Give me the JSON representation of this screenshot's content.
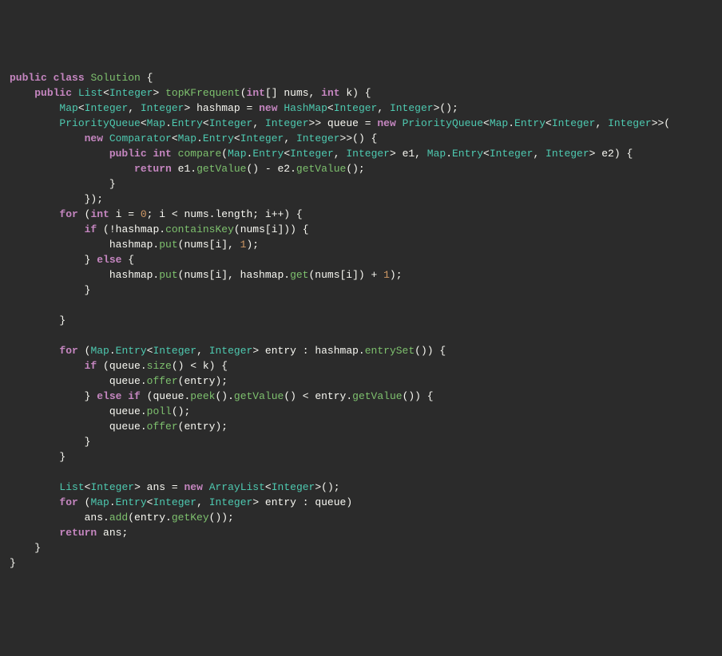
{
  "code_tokens": [
    [
      {
        "t": "public",
        "c": "kw"
      },
      {
        "t": " ",
        "c": "op"
      },
      {
        "t": "class",
        "c": "kw"
      },
      {
        "t": " ",
        "c": "op"
      },
      {
        "t": "Solution",
        "c": "cls"
      },
      {
        "t": " {",
        "c": "punc"
      }
    ],
    [
      {
        "t": "    ",
        "c": "op"
      },
      {
        "t": "public",
        "c": "kw"
      },
      {
        "t": " ",
        "c": "op"
      },
      {
        "t": "List",
        "c": "type"
      },
      {
        "t": "<",
        "c": "punc"
      },
      {
        "t": "Integer",
        "c": "type"
      },
      {
        "t": "> ",
        "c": "punc"
      },
      {
        "t": "topKFrequent",
        "c": "method"
      },
      {
        "t": "(",
        "c": "punc"
      },
      {
        "t": "int",
        "c": "kw"
      },
      {
        "t": "[] nums, ",
        "c": "punc"
      },
      {
        "t": "int",
        "c": "kw"
      },
      {
        "t": " k) {",
        "c": "punc"
      }
    ],
    [
      {
        "t": "        ",
        "c": "op"
      },
      {
        "t": "Map",
        "c": "type"
      },
      {
        "t": "<",
        "c": "punc"
      },
      {
        "t": "Integer",
        "c": "type"
      },
      {
        "t": ", ",
        "c": "punc"
      },
      {
        "t": "Integer",
        "c": "type"
      },
      {
        "t": "> hashmap = ",
        "c": "punc"
      },
      {
        "t": "new",
        "c": "new"
      },
      {
        "t": " ",
        "c": "op"
      },
      {
        "t": "HashMap",
        "c": "type"
      },
      {
        "t": "<",
        "c": "punc"
      },
      {
        "t": "Integer",
        "c": "type"
      },
      {
        "t": ", ",
        "c": "punc"
      },
      {
        "t": "Integer",
        "c": "type"
      },
      {
        "t": ">();",
        "c": "punc"
      }
    ],
    [
      {
        "t": "        ",
        "c": "op"
      },
      {
        "t": "PriorityQueue",
        "c": "type"
      },
      {
        "t": "<",
        "c": "punc"
      },
      {
        "t": "Map",
        "c": "type"
      },
      {
        "t": ".",
        "c": "punc"
      },
      {
        "t": "Entry",
        "c": "type"
      },
      {
        "t": "<",
        "c": "punc"
      },
      {
        "t": "Integer",
        "c": "type"
      },
      {
        "t": ", ",
        "c": "punc"
      },
      {
        "t": "Integer",
        "c": "type"
      },
      {
        "t": ">> queue = ",
        "c": "punc"
      },
      {
        "t": "new",
        "c": "new"
      },
      {
        "t": " ",
        "c": "op"
      },
      {
        "t": "PriorityQueue",
        "c": "type"
      },
      {
        "t": "<",
        "c": "punc"
      },
      {
        "t": "Map",
        "c": "type"
      },
      {
        "t": ".",
        "c": "punc"
      },
      {
        "t": "Entry",
        "c": "type"
      },
      {
        "t": "<",
        "c": "punc"
      },
      {
        "t": "Integer",
        "c": "type"
      },
      {
        "t": ", ",
        "c": "punc"
      },
      {
        "t": "Integer",
        "c": "type"
      },
      {
        "t": ">>(",
        "c": "punc"
      }
    ],
    [
      {
        "t": "            ",
        "c": "op"
      },
      {
        "t": "new",
        "c": "new"
      },
      {
        "t": " ",
        "c": "op"
      },
      {
        "t": "Comparator",
        "c": "type"
      },
      {
        "t": "<",
        "c": "punc"
      },
      {
        "t": "Map",
        "c": "type"
      },
      {
        "t": ".",
        "c": "punc"
      },
      {
        "t": "Entry",
        "c": "type"
      },
      {
        "t": "<",
        "c": "punc"
      },
      {
        "t": "Integer",
        "c": "type"
      },
      {
        "t": ", ",
        "c": "punc"
      },
      {
        "t": "Integer",
        "c": "type"
      },
      {
        "t": ">>() {",
        "c": "punc"
      }
    ],
    [
      {
        "t": "                ",
        "c": "op"
      },
      {
        "t": "public",
        "c": "kw"
      },
      {
        "t": " ",
        "c": "op"
      },
      {
        "t": "int",
        "c": "kw"
      },
      {
        "t": " ",
        "c": "op"
      },
      {
        "t": "compare",
        "c": "method"
      },
      {
        "t": "(",
        "c": "punc"
      },
      {
        "t": "Map",
        "c": "type"
      },
      {
        "t": ".",
        "c": "punc"
      },
      {
        "t": "Entry",
        "c": "type"
      },
      {
        "t": "<",
        "c": "punc"
      },
      {
        "t": "Integer",
        "c": "type"
      },
      {
        "t": ", ",
        "c": "punc"
      },
      {
        "t": "Integer",
        "c": "type"
      },
      {
        "t": "> e1, ",
        "c": "punc"
      },
      {
        "t": "Map",
        "c": "type"
      },
      {
        "t": ".",
        "c": "punc"
      },
      {
        "t": "Entry",
        "c": "type"
      },
      {
        "t": "<",
        "c": "punc"
      },
      {
        "t": "Integer",
        "c": "type"
      },
      {
        "t": ", ",
        "c": "punc"
      },
      {
        "t": "Integer",
        "c": "type"
      },
      {
        "t": "> e2) {",
        "c": "punc"
      }
    ],
    [
      {
        "t": "                    ",
        "c": "op"
      },
      {
        "t": "return",
        "c": "ret"
      },
      {
        "t": " e1.",
        "c": "punc"
      },
      {
        "t": "getValue",
        "c": "method"
      },
      {
        "t": "() - e2.",
        "c": "punc"
      },
      {
        "t": "getValue",
        "c": "method"
      },
      {
        "t": "();",
        "c": "punc"
      }
    ],
    [
      {
        "t": "                }",
        "c": "punc"
      }
    ],
    [
      {
        "t": "            });",
        "c": "punc"
      }
    ],
    [
      {
        "t": "        ",
        "c": "op"
      },
      {
        "t": "for",
        "c": "kw"
      },
      {
        "t": " (",
        "c": "punc"
      },
      {
        "t": "int",
        "c": "kw"
      },
      {
        "t": " i = ",
        "c": "punc"
      },
      {
        "t": "0",
        "c": "num"
      },
      {
        "t": "; i < nums.length; i++) {",
        "c": "punc"
      }
    ],
    [
      {
        "t": "            ",
        "c": "op"
      },
      {
        "t": "if",
        "c": "kw"
      },
      {
        "t": " (!hashmap.",
        "c": "punc"
      },
      {
        "t": "containsKey",
        "c": "method"
      },
      {
        "t": "(nums[i])) {",
        "c": "punc"
      }
    ],
    [
      {
        "t": "                hashmap.",
        "c": "punc"
      },
      {
        "t": "put",
        "c": "method"
      },
      {
        "t": "(nums[i], ",
        "c": "punc"
      },
      {
        "t": "1",
        "c": "num"
      },
      {
        "t": ");",
        "c": "punc"
      }
    ],
    [
      {
        "t": "            } ",
        "c": "punc"
      },
      {
        "t": "else",
        "c": "kw"
      },
      {
        "t": " {",
        "c": "punc"
      }
    ],
    [
      {
        "t": "                hashmap.",
        "c": "punc"
      },
      {
        "t": "put",
        "c": "method"
      },
      {
        "t": "(nums[i], hashmap.",
        "c": "punc"
      },
      {
        "t": "get",
        "c": "method"
      },
      {
        "t": "(nums[i]) + ",
        "c": "punc"
      },
      {
        "t": "1",
        "c": "num"
      },
      {
        "t": ");",
        "c": "punc"
      }
    ],
    [
      {
        "t": "            }",
        "c": "punc"
      }
    ],
    [
      {
        "t": "",
        "c": "punc"
      }
    ],
    [
      {
        "t": "        }",
        "c": "punc"
      }
    ],
    [
      {
        "t": "",
        "c": "punc"
      }
    ],
    [
      {
        "t": "        ",
        "c": "op"
      },
      {
        "t": "for",
        "c": "kw"
      },
      {
        "t": " (",
        "c": "punc"
      },
      {
        "t": "Map",
        "c": "type"
      },
      {
        "t": ".",
        "c": "punc"
      },
      {
        "t": "Entry",
        "c": "type"
      },
      {
        "t": "<",
        "c": "punc"
      },
      {
        "t": "Integer",
        "c": "type"
      },
      {
        "t": ", ",
        "c": "punc"
      },
      {
        "t": "Integer",
        "c": "type"
      },
      {
        "t": "> entry : hashmap.",
        "c": "punc"
      },
      {
        "t": "entrySet",
        "c": "method"
      },
      {
        "t": "()) {",
        "c": "punc"
      }
    ],
    [
      {
        "t": "            ",
        "c": "op"
      },
      {
        "t": "if",
        "c": "kw"
      },
      {
        "t": " (queue.",
        "c": "punc"
      },
      {
        "t": "size",
        "c": "method"
      },
      {
        "t": "() < k) {",
        "c": "punc"
      }
    ],
    [
      {
        "t": "                queue.",
        "c": "punc"
      },
      {
        "t": "offer",
        "c": "method"
      },
      {
        "t": "(entry);",
        "c": "punc"
      }
    ],
    [
      {
        "t": "            } ",
        "c": "punc"
      },
      {
        "t": "else",
        "c": "kw"
      },
      {
        "t": " ",
        "c": "op"
      },
      {
        "t": "if",
        "c": "kw"
      },
      {
        "t": " (queue.",
        "c": "punc"
      },
      {
        "t": "peek",
        "c": "method"
      },
      {
        "t": "().",
        "c": "punc"
      },
      {
        "t": "getValue",
        "c": "method"
      },
      {
        "t": "() < entry.",
        "c": "punc"
      },
      {
        "t": "getValue",
        "c": "method"
      },
      {
        "t": "()) {",
        "c": "punc"
      }
    ],
    [
      {
        "t": "                queue.",
        "c": "punc"
      },
      {
        "t": "poll",
        "c": "method"
      },
      {
        "t": "();",
        "c": "punc"
      }
    ],
    [
      {
        "t": "                queue.",
        "c": "punc"
      },
      {
        "t": "offer",
        "c": "method"
      },
      {
        "t": "(entry);",
        "c": "punc"
      }
    ],
    [
      {
        "t": "            }",
        "c": "punc"
      }
    ],
    [
      {
        "t": "        }",
        "c": "punc"
      }
    ],
    [
      {
        "t": "",
        "c": "punc"
      }
    ],
    [
      {
        "t": "        ",
        "c": "op"
      },
      {
        "t": "List",
        "c": "type"
      },
      {
        "t": "<",
        "c": "punc"
      },
      {
        "t": "Integer",
        "c": "type"
      },
      {
        "t": "> ans = ",
        "c": "punc"
      },
      {
        "t": "new",
        "c": "new"
      },
      {
        "t": " ",
        "c": "op"
      },
      {
        "t": "ArrayList",
        "c": "type"
      },
      {
        "t": "<",
        "c": "punc"
      },
      {
        "t": "Integer",
        "c": "type"
      },
      {
        "t": ">();",
        "c": "punc"
      }
    ],
    [
      {
        "t": "        ",
        "c": "op"
      },
      {
        "t": "for",
        "c": "kw"
      },
      {
        "t": " (",
        "c": "punc"
      },
      {
        "t": "Map",
        "c": "type"
      },
      {
        "t": ".",
        "c": "punc"
      },
      {
        "t": "Entry",
        "c": "type"
      },
      {
        "t": "<",
        "c": "punc"
      },
      {
        "t": "Integer",
        "c": "type"
      },
      {
        "t": ", ",
        "c": "punc"
      },
      {
        "t": "Integer",
        "c": "type"
      },
      {
        "t": "> entry : queue)",
        "c": "punc"
      }
    ],
    [
      {
        "t": "            ans.",
        "c": "punc"
      },
      {
        "t": "add",
        "c": "method"
      },
      {
        "t": "(entry.",
        "c": "punc"
      },
      {
        "t": "getKey",
        "c": "method"
      },
      {
        "t": "());",
        "c": "punc"
      }
    ],
    [
      {
        "t": "        ",
        "c": "op"
      },
      {
        "t": "return",
        "c": "ret"
      },
      {
        "t": " ans;",
        "c": "punc"
      }
    ],
    [
      {
        "t": "    }",
        "c": "punc"
      }
    ],
    [
      {
        "t": "}",
        "c": "punc"
      }
    ]
  ]
}
